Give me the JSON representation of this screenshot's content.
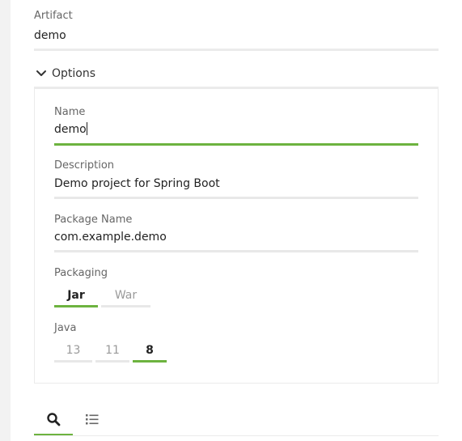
{
  "artifact": {
    "label": "Artifact",
    "value": "demo"
  },
  "options": {
    "toggle_label": "Options",
    "name": {
      "label": "Name",
      "value": "demo"
    },
    "description": {
      "label": "Description",
      "value": "Demo project for Spring Boot"
    },
    "package_name": {
      "label": "Package Name",
      "value": "com.example.demo"
    },
    "packaging": {
      "label": "Packaging",
      "options": [
        "Jar",
        "War"
      ],
      "selected": "Jar"
    },
    "java": {
      "label": "Java",
      "options": [
        "13",
        "11",
        "8"
      ],
      "selected": "8"
    }
  },
  "tabs": [
    {
      "icon": "search-icon",
      "active": true
    },
    {
      "icon": "list-icon",
      "active": false
    }
  ],
  "colors": {
    "accent": "#6db33f",
    "line": "#e8e8e8",
    "label": "#666666"
  }
}
